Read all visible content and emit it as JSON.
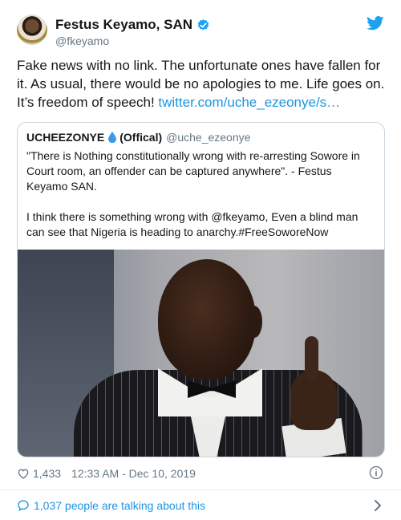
{
  "author": {
    "name": "Festus Keyamo, SAN",
    "handle": "@fkeyamo"
  },
  "tweet": {
    "text": "Fake news with no link. The unfortunate ones have fallen for it. As usual, there would be no apologies to me. Life goes on. It’s freedom of speech! ",
    "link": "twitter.com/uche_ezeonye/s…"
  },
  "quoted": {
    "name": "UCHEEZONYE",
    "flag": "(Offical)",
    "handle": "@uche_ezeonye",
    "paragraph1": "\"There is Nothing constitutionally wrong with re-arresting Sowore in Court room, an offender can be captured anywhere\". - Festus Keyamo SAN.",
    "paragraph2": "I think there is something wrong with @fkeyamo, Even a blind man can see that Nigeria is heading to anarchy.#FreeSoworeNow"
  },
  "footer": {
    "likes": "1,433",
    "timestamp": "12:33 AM - Dec 10, 2019",
    "talking": "1,037 people are talking about this"
  },
  "colors": {
    "link": "#1b95e0",
    "secondary": "#657786",
    "verified": "#1da1f2",
    "border": "#ccd6dd"
  },
  "icons": [
    "verified-badge-icon",
    "twitter-bird-icon",
    "water-drop-icon",
    "heart-icon",
    "info-icon",
    "speech-bubble-icon",
    "chevron-right-icon"
  ]
}
